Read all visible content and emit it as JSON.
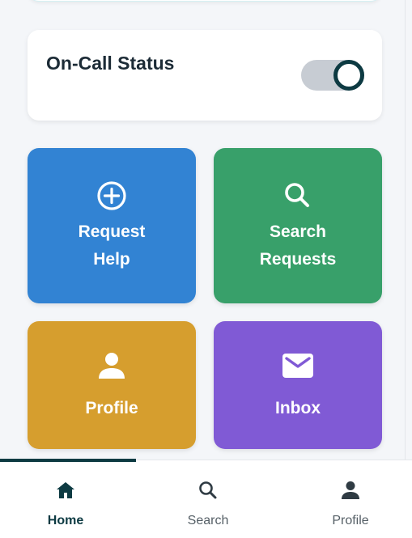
{
  "status": {
    "title": "On-Call Status",
    "toggle_on": true
  },
  "tiles": [
    {
      "label": "Request Help",
      "icon": "plus-circle-icon",
      "color": "#3283d3"
    },
    {
      "label": "Search Requests",
      "icon": "search-icon",
      "color": "#38a06a"
    },
    {
      "label": "Profile",
      "icon": "person-icon",
      "color": "#d69e2e"
    },
    {
      "label": "Inbox",
      "icon": "mail-icon",
      "color": "#805ad5"
    }
  ],
  "nav": {
    "items": [
      {
        "label": "Home",
        "icon": "home-icon",
        "active": true
      },
      {
        "label": "Search",
        "icon": "search-icon",
        "active": false
      },
      {
        "label": "Profile",
        "icon": "person-icon",
        "active": false
      }
    ]
  },
  "colors": {
    "primary_dark": "#0d3a42",
    "toggle_track": "#c7ccd3"
  }
}
